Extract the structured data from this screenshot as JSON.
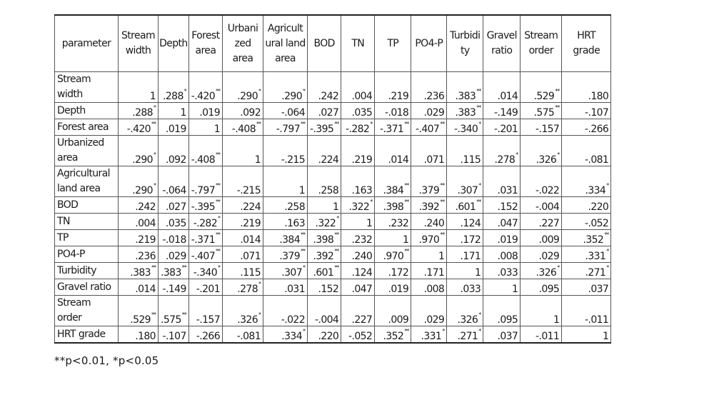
{
  "table": {
    "columns": [
      {
        "label": "parameter"
      },
      {
        "label": "Stream width"
      },
      {
        "label": "Depth"
      },
      {
        "label": "Forest area"
      },
      {
        "label": "Urbanized area"
      },
      {
        "label": "Agricultural land area"
      },
      {
        "label": "BOD"
      },
      {
        "label": "TN"
      },
      {
        "label": "TP"
      },
      {
        "label": "PO4-P"
      },
      {
        "label": "Turbidity"
      },
      {
        "label": "Gravel ratio"
      },
      {
        "label": "Stream order"
      },
      {
        "label": "HRT grade"
      }
    ],
    "header_display": [
      "parameter",
      "Stream width",
      "Depth",
      "Forest area",
      "Urbani zed area",
      "Agricult ural land area",
      "BOD",
      "TN",
      "TP",
      "PO4-P",
      "Turbidi ty",
      "Gravel ratio",
      "Stream order",
      "HRT grade"
    ],
    "rows": [
      {
        "label": "Stream width",
        "tall": false,
        "cells": [
          {
            "v": "1",
            "s": ""
          },
          {
            "v": ".288",
            "s": "*"
          },
          {
            "v": "-.420",
            "s": "**"
          },
          {
            "v": ".290",
            "s": "*"
          },
          {
            "v": ".290",
            "s": "*"
          },
          {
            "v": ".242",
            "s": ""
          },
          {
            "v": ".004",
            "s": ""
          },
          {
            "v": ".219",
            "s": ""
          },
          {
            "v": ".236",
            "s": ""
          },
          {
            "v": ".383",
            "s": "**"
          },
          {
            "v": ".014",
            "s": ""
          },
          {
            "v": ".529",
            "s": "**"
          },
          {
            "v": ".180",
            "s": ""
          }
        ]
      },
      {
        "label": "Depth",
        "tall": false,
        "cells": [
          {
            "v": ".288",
            "s": "*"
          },
          {
            "v": "1",
            "s": ""
          },
          {
            "v": ".019",
            "s": ""
          },
          {
            "v": ".092",
            "s": ""
          },
          {
            "v": "-.064",
            "s": ""
          },
          {
            "v": ".027",
            "s": ""
          },
          {
            "v": ".035",
            "s": ""
          },
          {
            "v": "-.018",
            "s": ""
          },
          {
            "v": ".029",
            "s": ""
          },
          {
            "v": ".383",
            "s": "**"
          },
          {
            "v": "-.149",
            "s": ""
          },
          {
            "v": ".575",
            "s": "**"
          },
          {
            "v": "-.107",
            "s": ""
          }
        ]
      },
      {
        "label": "Forest area",
        "tall": false,
        "cells": [
          {
            "v": "-.420",
            "s": "**"
          },
          {
            "v": ".019",
            "s": ""
          },
          {
            "v": "1",
            "s": ""
          },
          {
            "v": "-.408",
            "s": "**"
          },
          {
            "v": "-.797",
            "s": "**"
          },
          {
            "v": "-.395",
            "s": "**"
          },
          {
            "v": "-.282",
            "s": "*"
          },
          {
            "v": "-.371",
            "s": "**"
          },
          {
            "v": "-.407",
            "s": "**"
          },
          {
            "v": "-.340",
            "s": "*"
          },
          {
            "v": "-.201",
            "s": ""
          },
          {
            "v": "-.157",
            "s": ""
          },
          {
            "v": "-.266",
            "s": ""
          }
        ]
      },
      {
        "label": "Urbanized area",
        "tall": true,
        "cells": [
          {
            "v": ".290",
            "s": "*"
          },
          {
            "v": ".092",
            "s": ""
          },
          {
            "v": "-.408",
            "s": "**"
          },
          {
            "v": "1",
            "s": ""
          },
          {
            "v": "-.215",
            "s": ""
          },
          {
            "v": ".224",
            "s": ""
          },
          {
            "v": ".219",
            "s": ""
          },
          {
            "v": ".014",
            "s": ""
          },
          {
            "v": ".071",
            "s": ""
          },
          {
            "v": ".115",
            "s": ""
          },
          {
            "v": ".278",
            "s": "*"
          },
          {
            "v": ".326",
            "s": "*"
          },
          {
            "v": "-.081",
            "s": ""
          }
        ]
      },
      {
        "label": "Agricultural land area",
        "tall": true,
        "cells": [
          {
            "v": ".290",
            "s": "*"
          },
          {
            "v": "-.064",
            "s": ""
          },
          {
            "v": "-.797",
            "s": "**"
          },
          {
            "v": "-.215",
            "s": ""
          },
          {
            "v": "1",
            "s": ""
          },
          {
            "v": ".258",
            "s": ""
          },
          {
            "v": ".163",
            "s": ""
          },
          {
            "v": ".384",
            "s": "**"
          },
          {
            "v": ".379",
            "s": "**"
          },
          {
            "v": ".307",
            "s": "*"
          },
          {
            "v": ".031",
            "s": ""
          },
          {
            "v": "-.022",
            "s": ""
          },
          {
            "v": ".334",
            "s": "*"
          }
        ]
      },
      {
        "label": "BOD",
        "tall": false,
        "cells": [
          {
            "v": ".242",
            "s": ""
          },
          {
            "v": ".027",
            "s": ""
          },
          {
            "v": "-.395",
            "s": "**"
          },
          {
            "v": ".224",
            "s": ""
          },
          {
            "v": ".258",
            "s": ""
          },
          {
            "v": "1",
            "s": ""
          },
          {
            "v": ".322",
            "s": "*"
          },
          {
            "v": ".398",
            "s": "**"
          },
          {
            "v": ".392",
            "s": "**"
          },
          {
            "v": ".601",
            "s": "**"
          },
          {
            "v": ".152",
            "s": ""
          },
          {
            "v": "-.004",
            "s": ""
          },
          {
            "v": ".220",
            "s": ""
          }
        ]
      },
      {
        "label": "TN",
        "tall": false,
        "cells": [
          {
            "v": ".004",
            "s": ""
          },
          {
            "v": ".035",
            "s": ""
          },
          {
            "v": "-.282",
            "s": "*"
          },
          {
            "v": ".219",
            "s": ""
          },
          {
            "v": ".163",
            "s": ""
          },
          {
            "v": ".322",
            "s": "*"
          },
          {
            "v": "1",
            "s": ""
          },
          {
            "v": ".232",
            "s": ""
          },
          {
            "v": ".240",
            "s": ""
          },
          {
            "v": ".124",
            "s": ""
          },
          {
            "v": ".047",
            "s": ""
          },
          {
            "v": ".227",
            "s": ""
          },
          {
            "v": "-.052",
            "s": ""
          }
        ]
      },
      {
        "label": "TP",
        "tall": false,
        "cells": [
          {
            "v": ".219",
            "s": ""
          },
          {
            "v": "-.018",
            "s": ""
          },
          {
            "v": "-.371",
            "s": "**"
          },
          {
            "v": ".014",
            "s": ""
          },
          {
            "v": ".384",
            "s": "**"
          },
          {
            "v": ".398",
            "s": "**"
          },
          {
            "v": ".232",
            "s": ""
          },
          {
            "v": "1",
            "s": ""
          },
          {
            "v": ".970",
            "s": "**"
          },
          {
            "v": ".172",
            "s": ""
          },
          {
            "v": ".019",
            "s": ""
          },
          {
            "v": ".009",
            "s": ""
          },
          {
            "v": ".352",
            "s": "**"
          }
        ]
      },
      {
        "label": "PO4-P",
        "tall": false,
        "cells": [
          {
            "v": ".236",
            "s": ""
          },
          {
            "v": ".029",
            "s": ""
          },
          {
            "v": "-.407",
            "s": "**"
          },
          {
            "v": ".071",
            "s": ""
          },
          {
            "v": ".379",
            "s": "**"
          },
          {
            "v": ".392",
            "s": "**"
          },
          {
            "v": ".240",
            "s": ""
          },
          {
            "v": ".970",
            "s": "**"
          },
          {
            "v": "1",
            "s": ""
          },
          {
            "v": ".171",
            "s": ""
          },
          {
            "v": ".008",
            "s": ""
          },
          {
            "v": ".029",
            "s": ""
          },
          {
            "v": ".331",
            "s": "*"
          }
        ]
      },
      {
        "label": "Turbidity",
        "tall": false,
        "cells": [
          {
            "v": ".383",
            "s": "**"
          },
          {
            "v": ".383",
            "s": "**"
          },
          {
            "v": "-.340",
            "s": "*"
          },
          {
            "v": ".115",
            "s": ""
          },
          {
            "v": ".307",
            "s": "*"
          },
          {
            "v": ".601",
            "s": "**"
          },
          {
            "v": ".124",
            "s": ""
          },
          {
            "v": ".172",
            "s": ""
          },
          {
            "v": ".171",
            "s": ""
          },
          {
            "v": "1",
            "s": ""
          },
          {
            "v": ".033",
            "s": ""
          },
          {
            "v": ".326",
            "s": "*"
          },
          {
            "v": ".271",
            "s": "*"
          }
        ]
      },
      {
        "label": "Gravel ratio",
        "tall": false,
        "cells": [
          {
            "v": ".014",
            "s": ""
          },
          {
            "v": "-.149",
            "s": ""
          },
          {
            "v": "-.201",
            "s": ""
          },
          {
            "v": ".278",
            "s": "*"
          },
          {
            "v": ".031",
            "s": ""
          },
          {
            "v": ".152",
            "s": ""
          },
          {
            "v": ".047",
            "s": ""
          },
          {
            "v": ".019",
            "s": ""
          },
          {
            "v": ".008",
            "s": ""
          },
          {
            "v": ".033",
            "s": ""
          },
          {
            "v": "1",
            "s": ""
          },
          {
            "v": ".095",
            "s": ""
          },
          {
            "v": ".037",
            "s": ""
          }
        ]
      },
      {
        "label": "Stream order",
        "tall": false,
        "cells": [
          {
            "v": ".529",
            "s": "**"
          },
          {
            "v": ".575",
            "s": "**"
          },
          {
            "v": "-.157",
            "s": ""
          },
          {
            "v": ".326",
            "s": "*"
          },
          {
            "v": "-.022",
            "s": ""
          },
          {
            "v": "-.004",
            "s": ""
          },
          {
            "v": ".227",
            "s": ""
          },
          {
            "v": ".009",
            "s": ""
          },
          {
            "v": ".029",
            "s": ""
          },
          {
            "v": ".326",
            "s": "*"
          },
          {
            "v": ".095",
            "s": ""
          },
          {
            "v": "1",
            "s": ""
          },
          {
            "v": "-.011",
            "s": ""
          }
        ]
      },
      {
        "label": "HRT grade",
        "tall": false,
        "cells": [
          {
            "v": ".180",
            "s": ""
          },
          {
            "v": "-.107",
            "s": ""
          },
          {
            "v": "-.266",
            "s": ""
          },
          {
            "v": "-.081",
            "s": ""
          },
          {
            "v": ".334",
            "s": "*"
          },
          {
            "v": ".220",
            "s": ""
          },
          {
            "v": "-.052",
            "s": ""
          },
          {
            "v": ".352",
            "s": "**"
          },
          {
            "v": ".331",
            "s": "*"
          },
          {
            "v": ".271",
            "s": "*"
          },
          {
            "v": ".037",
            "s": ""
          },
          {
            "v": "-.011",
            "s": ""
          },
          {
            "v": "1",
            "s": ""
          }
        ]
      }
    ]
  },
  "footnote": "**p<0.01,  *p<0.05"
}
